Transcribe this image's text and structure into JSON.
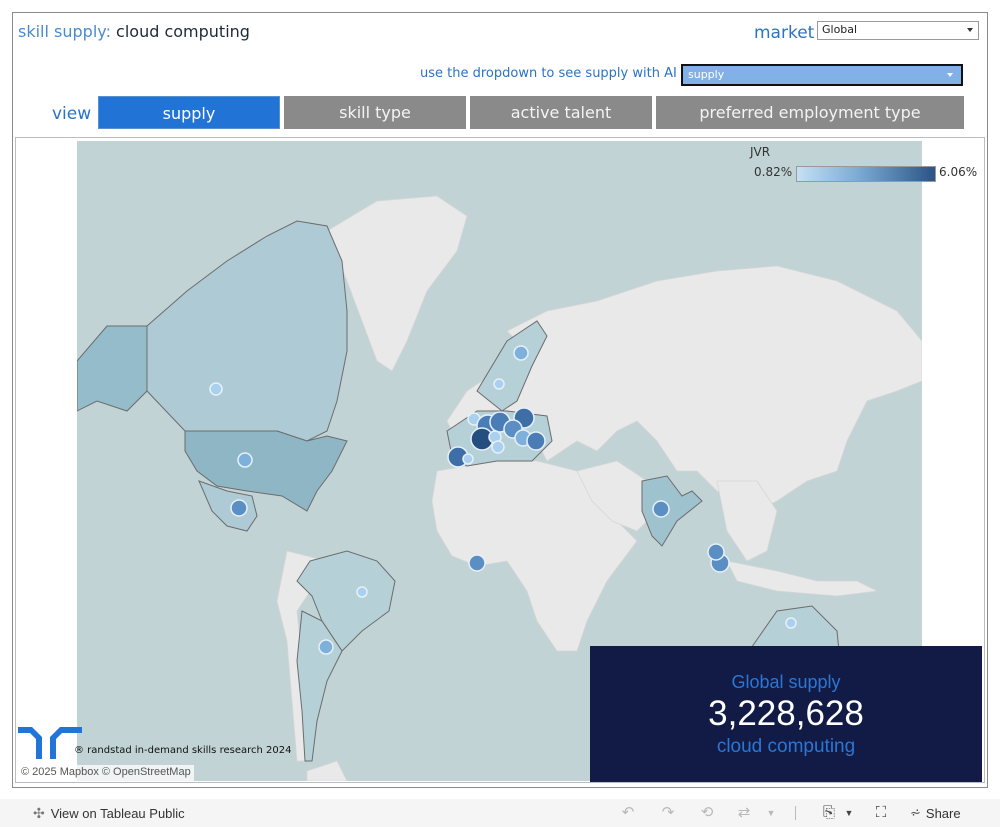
{
  "header": {
    "title_label": "skill supply:",
    "title_value": "cloud computing",
    "market_label": "market",
    "market_selected": "Global",
    "ai_prompt": "use the dropdown to see supply with AI",
    "ai_selected": "supply",
    "view_label": "view"
  },
  "tabs": [
    {
      "label": "supply",
      "active": true
    },
    {
      "label": "skill type",
      "active": false
    },
    {
      "label": "active talent",
      "active": false
    },
    {
      "label": "preferred employment type",
      "active": false
    }
  ],
  "legend": {
    "title": "JVR",
    "min": "0.82%",
    "max": "6.06%",
    "color_low": "#c4e0f4",
    "color_high": "#2b5484"
  },
  "kpi": {
    "line1": "Global supply",
    "value": "3,228,628",
    "line3": "cloud computing"
  },
  "credits": {
    "research": "® randstad in-demand skills research 2024",
    "mapbox": "© 2025 Mapbox",
    "osm": "© OpenStreetMap"
  },
  "map_markers": [
    {
      "region": "Canada",
      "jvr": "low"
    },
    {
      "region": "United States",
      "jvr": "low-mid"
    },
    {
      "region": "Mexico",
      "jvr": "mid"
    },
    {
      "region": "Brazil",
      "jvr": "low"
    },
    {
      "region": "Argentina",
      "jvr": "low-mid"
    },
    {
      "region": "West Africa (Gulf of Guinea)",
      "jvr": "mid"
    },
    {
      "region": "Sweden",
      "jvr": "low-mid"
    },
    {
      "region": "Norway",
      "jvr": "low"
    },
    {
      "region": "United Kingdom",
      "jvr": "low"
    },
    {
      "region": "Netherlands",
      "jvr": "mid"
    },
    {
      "region": "Belgium",
      "jvr": "mid-high"
    },
    {
      "region": "Germany",
      "jvr": "mid-high"
    },
    {
      "region": "Poland",
      "jvr": "high"
    },
    {
      "region": "Czechia",
      "jvr": "mid"
    },
    {
      "region": "France",
      "jvr": "highest"
    },
    {
      "region": "Switzerland",
      "jvr": "low"
    },
    {
      "region": "Austria/Hungary",
      "jvr": "low-mid"
    },
    {
      "region": "Italy",
      "jvr": "low"
    },
    {
      "region": "Romania",
      "jvr": "mid-high"
    },
    {
      "region": "Spain",
      "jvr": "high"
    },
    {
      "region": "Portugal",
      "jvr": "low"
    },
    {
      "region": "India",
      "jvr": "mid"
    },
    {
      "region": "Singapore",
      "jvr": "mid"
    },
    {
      "region": "Malaysia",
      "jvr": "mid"
    },
    {
      "region": "Australia",
      "jvr": "low"
    }
  ],
  "footer": {
    "tableau_link": "View on Tableau Public",
    "share_label": "Share"
  }
}
